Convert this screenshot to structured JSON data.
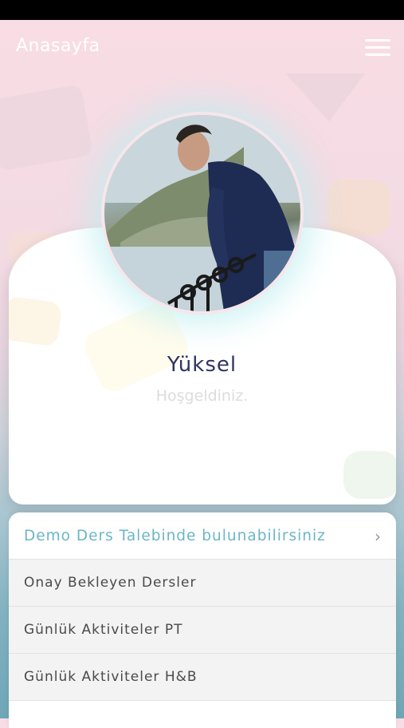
{
  "header": {
    "title": "Anasayfa"
  },
  "profile": {
    "name": "Yüksel",
    "welcome": "Hoşgeldiniz."
  },
  "menu": {
    "items": [
      {
        "label": "Demo Ders Talebinde bulunabilirsiniz"
      },
      {
        "label": "Onay Bekleyen Dersler"
      },
      {
        "label": "Günlük Aktiviteler PT"
      },
      {
        "label": "Günlük Aktiviteler H&B"
      },
      {
        "label": ""
      }
    ]
  },
  "colors": {
    "accent": "#6bb6c6",
    "name_text": "#2f3561"
  },
  "icons": {
    "menu": "hamburger-icon",
    "chevron": "chevron-right-icon"
  }
}
